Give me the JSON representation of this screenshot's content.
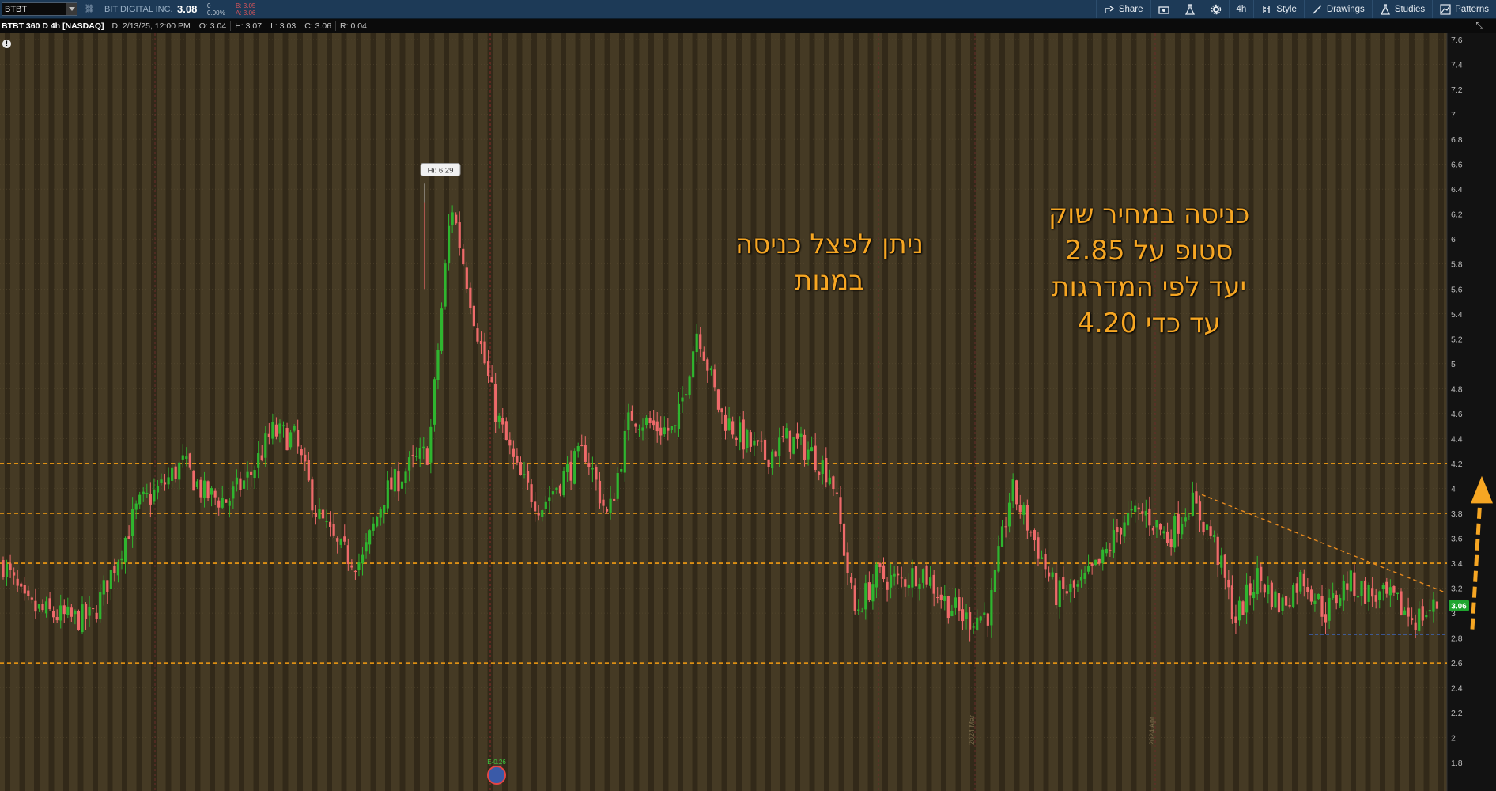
{
  "toolbar": {
    "symbol": "BTBT",
    "company": "BIT DIGITAL INC.",
    "last": "3.08",
    "change": "0",
    "change_pct": "0.00%",
    "bid": "B: 3.05",
    "ask": "A: 3.06",
    "share": "Share",
    "timeframe": "4h",
    "style": "Style",
    "drawings": "Drawings",
    "studies": "Studies",
    "patterns": "Patterns"
  },
  "infobar": {
    "title": "BTBT 360 D 4h [NASDAQ]",
    "date": "D: 2/13/25, 12:00 PM",
    "open": "O: 3.04",
    "high": "H: 3.07",
    "low": "L: 3.03",
    "close": "C: 3.06",
    "range": "R: 0.04"
  },
  "annotations": {
    "left_line1": "ניתן לפצל כניסה",
    "left_line2": "במנות",
    "right_line1": "כניסה במחיר שוק",
    "right_line2": "סטופ על 2.85",
    "right_line3": "יעד לפי המדרגות",
    "right_line4": "עד כדי 4.20"
  },
  "colors": {
    "background": "#453a24",
    "band": "#2f2718",
    "up_candle": "#2fb52f",
    "down_candle": "#ee6a6a",
    "level_line": "#f39c12",
    "trend_line": "#e88a1e",
    "support_line": "#3f6fd8",
    "annotation": "#f6a623",
    "price_tag": "#1fa52f"
  },
  "chart_data": {
    "type": "candlestick",
    "symbol": "BTBT",
    "interval": "4h",
    "ylim": [
      1.7,
      7.6
    ],
    "y_ticks": [
      "7.6",
      "7.4",
      "7.2",
      "7",
      "6.8",
      "6.6",
      "6.4",
      "6.2",
      "6",
      "5.8",
      "5.6",
      "5.4",
      "5.2",
      "5",
      "4.8",
      "4.6",
      "4.4",
      "4.2",
      "4",
      "3.8",
      "3.6",
      "3.4",
      "3.2",
      "3",
      "2.8",
      "2.6",
      "2.4",
      "2.2",
      "2",
      "1.8"
    ],
    "high_label": "Hi: 6.29",
    "high_value": 6.29,
    "earnings_label": "E-0.26",
    "current_price": "3.06",
    "horizontal_levels": [
      4.2,
      3.8,
      3.4,
      2.6
    ],
    "support_level": 2.83,
    "trend_line": {
      "from": 3.95,
      "to": 3.17
    },
    "price_path": [
      3.4,
      3.05,
      3.0,
      2.95,
      2.97,
      3.4,
      3.85,
      4.0,
      4.2,
      3.95,
      3.9,
      4.1,
      4.45,
      4.4,
      3.8,
      3.5,
      3.4,
      3.95,
      4.15,
      4.3,
      6.3,
      5.4,
      4.6,
      4.1,
      3.85,
      4.1,
      4.3,
      3.75,
      4.6,
      4.5,
      4.45,
      5.3,
      4.6,
      4.4,
      4.25,
      4.4,
      4.3,
      4.1,
      3.0,
      3.3,
      3.25,
      3.35,
      3.1,
      2.95,
      3.0,
      4.0,
      3.6,
      3.15,
      3.2,
      3.4,
      3.75,
      3.8,
      3.6,
      3.9,
      3.6,
      2.95,
      3.3,
      3.05,
      3.3,
      3.0,
      3.25,
      3.15,
      3.1,
      2.95,
      3.06
    ],
    "upper_panel_markers": [
      "2024 Mar",
      "2024 Apr"
    ],
    "title": "",
    "xlabel": "",
    "ylabel": ""
  }
}
